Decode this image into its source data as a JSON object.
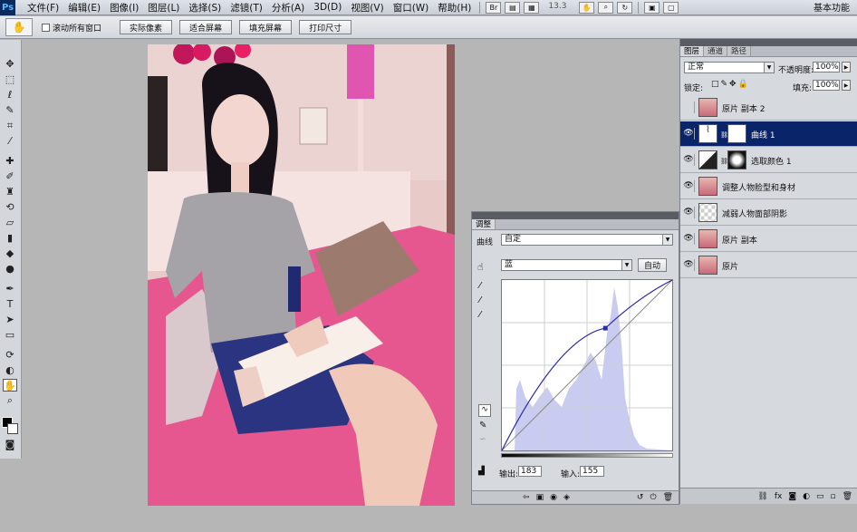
{
  "app": {
    "logo": "Ps"
  },
  "menu": [
    "文件(F)",
    "编辑(E)",
    "图像(I)",
    "图层(L)",
    "选择(S)",
    "滤镜(T)",
    "分析(A)",
    "3D(D)",
    "视图(V)",
    "窗口(W)",
    "帮助(H)"
  ],
  "menubar": {
    "zoom": "13.3",
    "workspace": "基本功能"
  },
  "options": {
    "scroll_all_label": "滚动所有窗口",
    "buttons": [
      "实际像素",
      "适合屏幕",
      "填充屏幕",
      "打印尺寸"
    ]
  },
  "colors": {
    "accent": "#0a246a",
    "panel_bg": "#d6d9dd",
    "app_bg": "#b6b6b6",
    "histogram": "#c9ccf0",
    "curve": "#2a2aa8",
    "sofa": "#e85a95"
  },
  "adjustments": {
    "tab": "调整",
    "preset_label": "曲线",
    "preset_value": "自定",
    "channel_value": "蓝",
    "auto_label": "自动",
    "output_label": "输出:",
    "output_value": "183",
    "input_label": "输入:",
    "input_value": "155",
    "curve_point": {
      "input": 155,
      "output": 183
    }
  },
  "layers": {
    "tabs": [
      "图层",
      "通道",
      "路径"
    ],
    "blend_mode": "正常",
    "opacity_label": "不透明度:",
    "opacity_value": "100%",
    "lock_label": "锁定:",
    "fill_label": "填充:",
    "fill_value": "100%",
    "items": [
      {
        "name": "原片 副本 2",
        "visible": false,
        "thumb": "photo"
      },
      {
        "name": "曲线 1",
        "visible": true,
        "thumb": "curves",
        "selected": true
      },
      {
        "name": "选取颜色 1",
        "visible": true,
        "thumb": "selective"
      },
      {
        "name": "调整人物脸型和身材",
        "visible": true,
        "thumb": "photo"
      },
      {
        "name": "减弱人物面部阴影",
        "visible": true,
        "thumb": "transparent"
      },
      {
        "name": "原片 副本",
        "visible": true,
        "thumb": "photo"
      },
      {
        "name": "原片",
        "visible": true,
        "thumb": "photo"
      }
    ]
  }
}
